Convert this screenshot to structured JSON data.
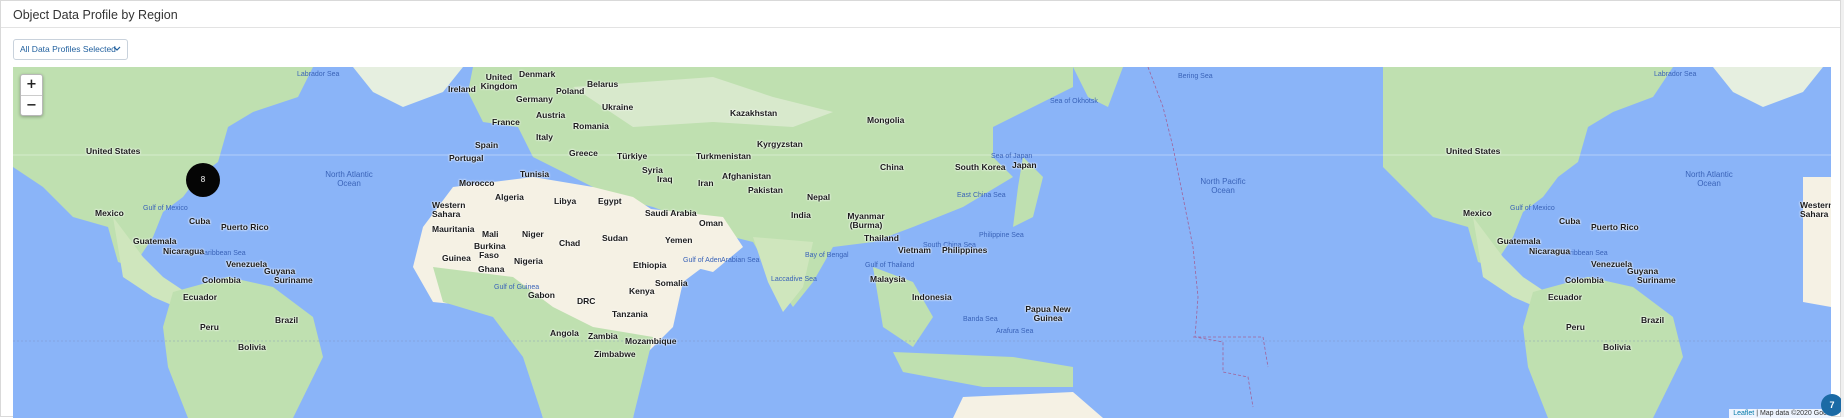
{
  "panel": {
    "title": "Object Data Profile by Region",
    "filter_label": "All Data Profiles Selected"
  },
  "map": {
    "zoom_in": "+",
    "zoom_out": "−",
    "cluster_count": "8",
    "attribution_leaflet": "Leaflet",
    "attribution_rest": "| Map data ©2020 Goo",
    "help_badge": "7",
    "colors": {
      "water": "#8ab4f8",
      "land": "#bfe0b0",
      "desert": "#f5f1e4"
    },
    "labels": {
      "labrador_sea_1": "Labrador Sea",
      "labrador_sea_2": "Labrador Sea",
      "bering_sea": "Bering Sea",
      "sea_of_okhotsk": "Sea of Okhotsk",
      "sea_of_japan": "Sea of Japan",
      "east_china_sea": "East China Sea",
      "philippine_sea": "Philippine Sea",
      "south_china_sea": "South China Sea",
      "gulf_of_thailand": "Gulf of Thailand",
      "bay_of_bengal": "Bay of Bengal",
      "arabian_sea": "Arabian Sea",
      "laccadive_sea": "Laccadive Sea",
      "gulf_of_mexico_1": "Gulf of Mexico",
      "gulf_of_mexico_2": "Gulf of Mexico",
      "caribbean_sea_1": "Caribbean Sea",
      "caribbean_sea_2": "Caribbean Sea",
      "gulf_of_guinea": "Gulf of Guinea",
      "gulf_of_aden": "Gulf of Aden",
      "banda_sea": "Banda Sea",
      "arafura_sea": "Arafura Sea",
      "north_atlantic_ocean_1": "North Atlantic Ocean",
      "north_atlantic_ocean_2": "North Atlantic Ocean",
      "north_pacific_ocean": "North Pacific Ocean",
      "united_states_1": "United States",
      "united_states_2": "United States",
      "mexico_1": "Mexico",
      "mexico_2": "Mexico",
      "cuba_1": "Cuba",
      "cuba_2": "Cuba",
      "puerto_rico_1": "Puerto Rico",
      "puerto_rico_2": "Puerto Rico",
      "guatemala_1": "Guatemala",
      "guatemala_2": "Guatemala",
      "nicaragua_1": "Nicaragua",
      "nicaragua_2": "Nicaragua",
      "venezuela_1": "Venezuela",
      "venezuela_2": "Venezuela",
      "guyana_1": "Guyana",
      "guyana_2": "Guyana",
      "suriname_1": "Suriname",
      "suriname_2": "Suriname",
      "colombia_1": "Colombia",
      "colombia_2": "Colombia",
      "ecuador_1": "Ecuador",
      "ecuador_2": "Ecuador",
      "peru_1": "Peru",
      "peru_2": "Peru",
      "brazil_1": "Brazil",
      "brazil_2": "Brazil",
      "bolivia_1": "Bolivia",
      "bolivia_2": "Bolivia",
      "ireland": "Ireland",
      "united_kingdom": "United Kingdom",
      "denmark": "Denmark",
      "belarus": "Belarus",
      "poland": "Poland",
      "germany": "Germany",
      "ukraine": "Ukraine",
      "austria": "Austria",
      "france": "France",
      "romania": "Romania",
      "italy": "Italy",
      "spain": "Spain",
      "portugal": "Portugal",
      "greece": "Greece",
      "turkiye": "Türkiye",
      "kazakhstan": "Kazakhstan",
      "mongolia": "Mongolia",
      "kyrgyzstan": "Kyrgyzstan",
      "turkmenistan": "Turkmenistan",
      "china": "China",
      "south_korea": "South Korea",
      "japan": "Japan",
      "afghanistan": "Afghanistan",
      "iran": "Iran",
      "iraq": "Iraq",
      "syria": "Syria",
      "pakistan": "Pakistan",
      "nepal": "Nepal",
      "india": "India",
      "myanmar": "Myanmar (Burma)",
      "thailand": "Thailand",
      "vietnam": "Vietnam",
      "philippines": "Philippines",
      "malaysia": "Malaysia",
      "indonesia": "Indonesia",
      "papua_new_guinea": "Papua New Guinea",
      "tunisia": "Tunisia",
      "morocco": "Morocco",
      "algeria": "Algeria",
      "libya": "Libya",
      "egypt": "Egypt",
      "saudi_arabia": "Saudi Arabia",
      "oman": "Oman",
      "yemen": "Yemen",
      "western_sahara_1": "Western Sahara",
      "western_sahara_2": "Western Sahara",
      "mauritania": "Mauritania",
      "mali": "Mali",
      "niger": "Niger",
      "chad": "Chad",
      "sudan": "Sudan",
      "ethiopia": "Ethiopia",
      "somalia": "Somalia",
      "kenya": "Kenya",
      "burkina_faso": "Burkina Faso",
      "guinea": "Guinea",
      "ghana": "Ghana",
      "nigeria": "Nigeria",
      "gabon": "Gabon",
      "drc": "DRC",
      "tanzania": "Tanzania",
      "angola": "Angola",
      "zambia": "Zambia",
      "mozambique": "Mozambique",
      "zimbabwe": "Zimbabwe"
    }
  }
}
